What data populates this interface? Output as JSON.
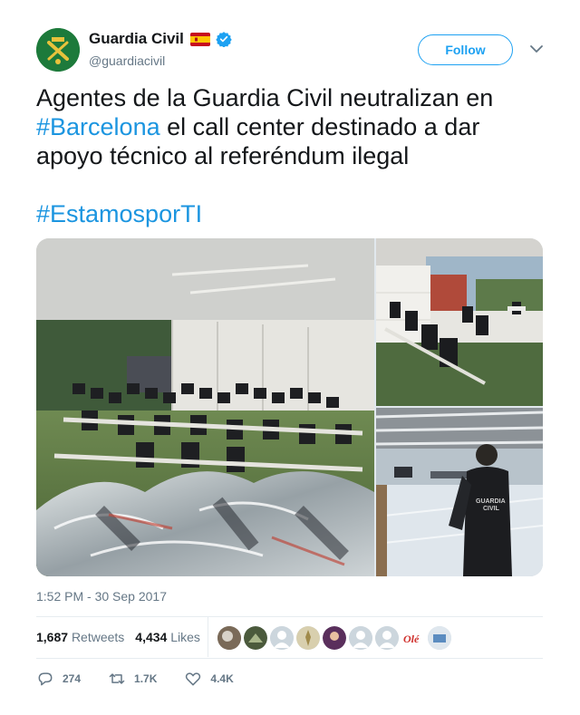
{
  "user": {
    "name": "Guardia Civil",
    "handle": "@guardiacivil",
    "flag": "spain-flag-icon",
    "verified": true
  },
  "header": {
    "follow_label": "Follow"
  },
  "tweet": {
    "text_part1": "Agentes de la Guardia Civil neutralizan en ",
    "hashtag1": "#Barcelona",
    "text_part2": " el call center destinado a dar apoyo técnico al referéndum ilegal",
    "hashtag2": "#EstamosporTI"
  },
  "timestamp": "1:52 PM - 30 Sep 2017",
  "stats": {
    "retweets_count": "1,687",
    "retweets_label": "Retweets",
    "likes_count": "4,434",
    "likes_label": "Likes",
    "liker_avatars": 10
  },
  "actions": {
    "reply_count": "274",
    "retweet_count": "1.7K",
    "like_count": "4.4K"
  },
  "colors": {
    "accent": "#1da1f2",
    "hashtag": "#1b95e0",
    "secondary_text": "#657786",
    "verified": "#1da1f2"
  }
}
